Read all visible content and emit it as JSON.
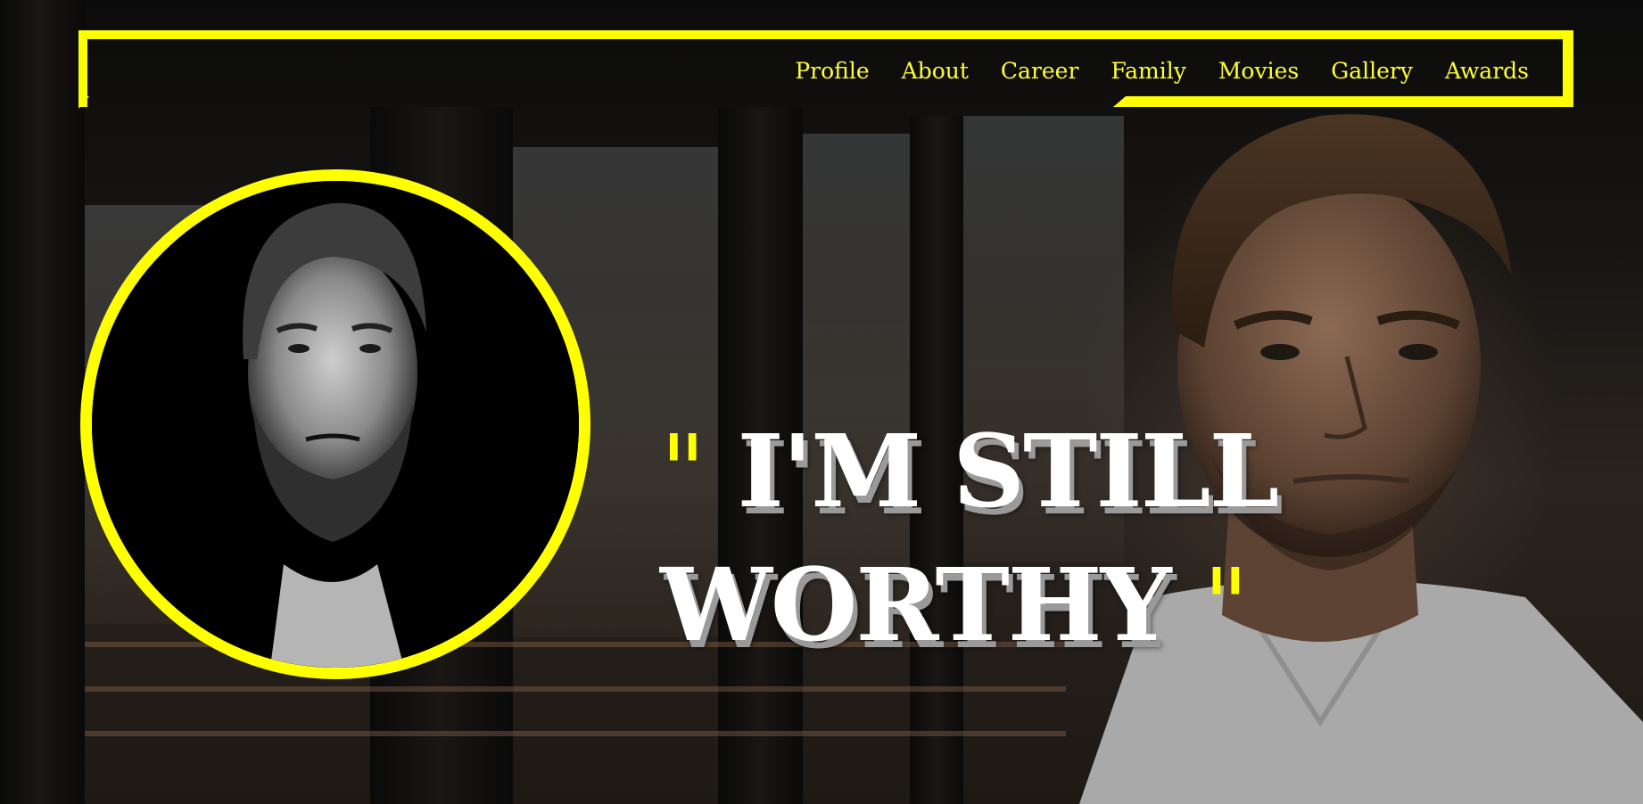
{
  "nav": {
    "items": [
      {
        "label": "Profile"
      },
      {
        "label": "About"
      },
      {
        "label": "Career"
      },
      {
        "label": "Family"
      },
      {
        "label": "Movies"
      },
      {
        "label": "Gallery"
      },
      {
        "label": "Awards"
      }
    ]
  },
  "hero": {
    "quote_open": "\"",
    "quote_line1": "I'M STILL",
    "quote_line2": "WORTHY",
    "quote_close": "\""
  },
  "colors": {
    "accent": "#ffff00",
    "text": "#ffffff",
    "background": "#0b0b0b"
  }
}
